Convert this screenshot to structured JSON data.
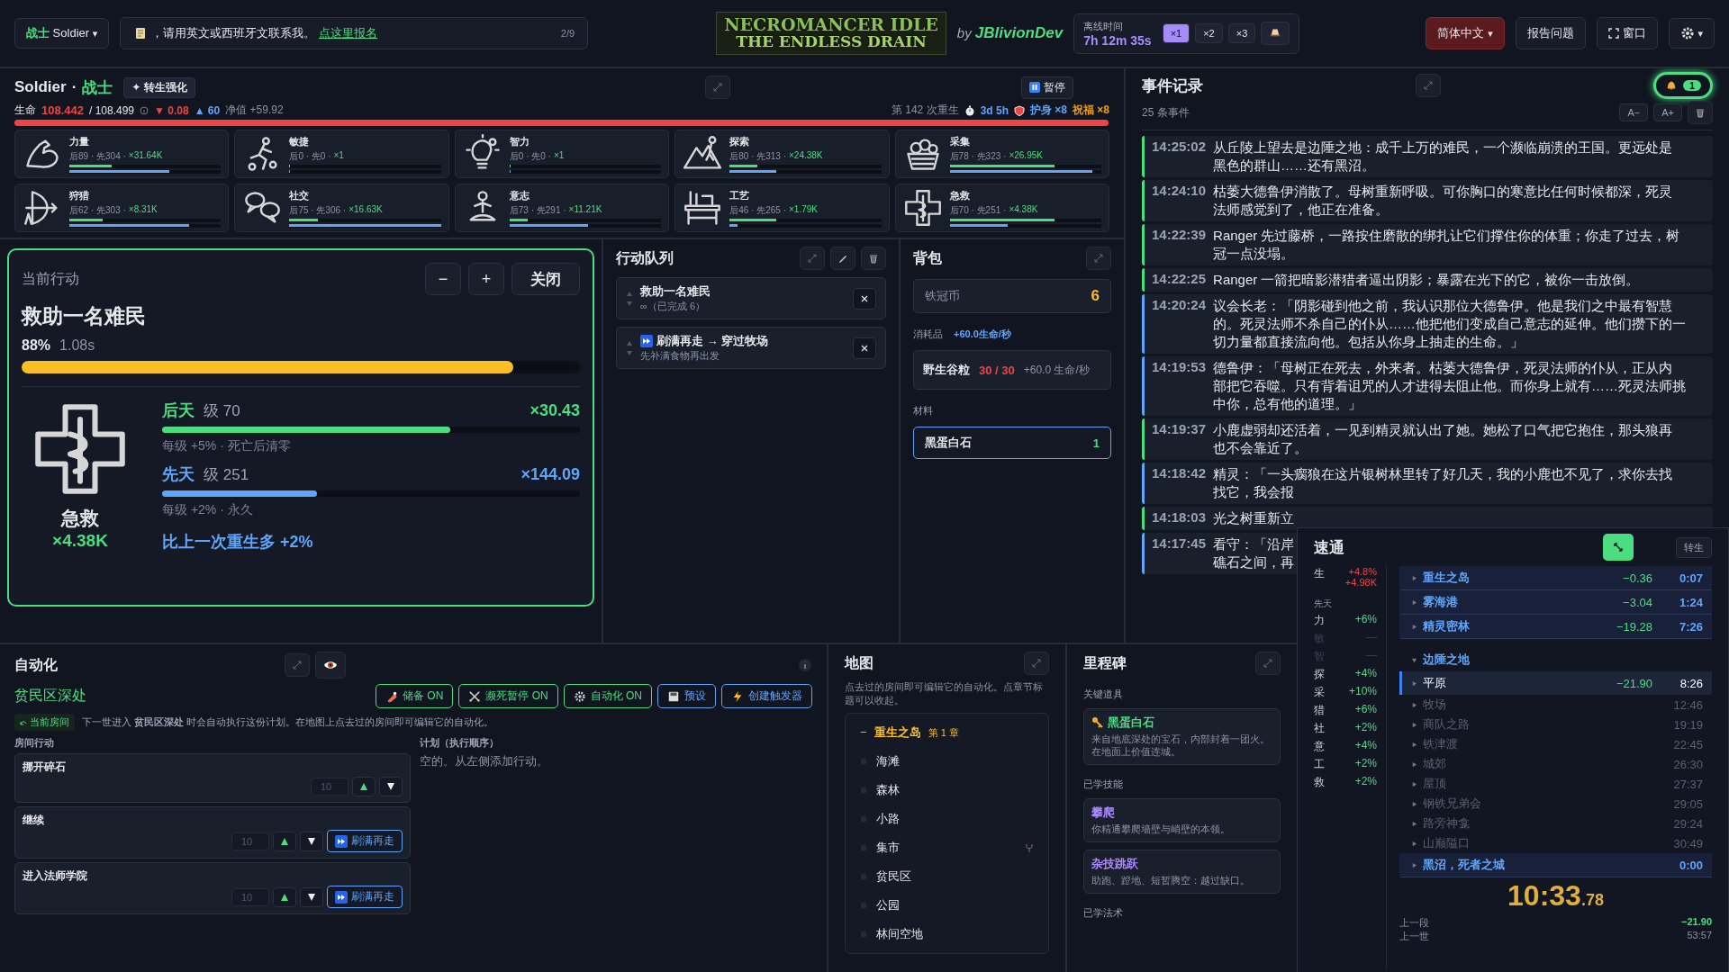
{
  "topbar": {
    "class_select": {
      "label": "战士",
      "value": "Soldier",
      "caret": "▾"
    },
    "notice": {
      "text": "，请用英文或西班牙文联系我。",
      "link": "点这里报名",
      "page": "2/9"
    },
    "logo": {
      "line1": "NECROMANCER IDLE",
      "line2": "THE ENDLESS DRAIN"
    },
    "byline": "by",
    "author": "JBlivionDev",
    "offline": {
      "label": "离线时间",
      "time": "7h 12m 35s"
    },
    "speeds": [
      {
        "label": "×1",
        "selected": true
      },
      {
        "label": "×2",
        "selected": false
      },
      {
        "label": "×3",
        "selected": false
      }
    ],
    "language": "简体中文",
    "language_caret": "▾",
    "report": "报告问题",
    "window_button": "窗口",
    "settings_caret": "▾"
  },
  "character": {
    "name": "Soldier",
    "separator": "·",
    "class": "战士",
    "rebirth_button": "✦ 转生强化",
    "pause_button": "暂停",
    "life_label": "生命",
    "life": "108.442",
    "life_max": "/ 108.499",
    "loss": "▼ 0.08",
    "gain": "▲ 60",
    "net": "净值 +59.92",
    "life_bar": {
      "level": 0.9995
    },
    "rebirths": "第 142 次重生",
    "age": "3d 5h",
    "ward": "护身 ×8",
    "blessing": "祝福 ×8"
  },
  "stats": [
    {
      "name": "力量",
      "detail": "后89 · 先304 ·",
      "mult": "×31.64K",
      "acquired_bar": {
        "level": 0.28
      },
      "innate_bar": {
        "level": 0.66
      }
    },
    {
      "name": "敏捷",
      "detail": "后0 · 先0 ·",
      "mult": "×1",
      "acquired_bar": {
        "level": 0
      },
      "innate_bar": {
        "level": 0
      }
    },
    {
      "name": "智力",
      "detail": "后0 · 先0 ·",
      "mult": "×1",
      "acquired_bar": {
        "level": 0
      },
      "innate_bar": {
        "level": 0
      }
    },
    {
      "name": "探索",
      "detail": "后80 · 先313 ·",
      "mult": "×24.38K",
      "acquired_bar": {
        "level": 0.18
      },
      "innate_bar": {
        "level": 0.31
      }
    },
    {
      "name": "采集",
      "detail": "后78 · 先323 ·",
      "mult": "×26.95K",
      "acquired_bar": {
        "level": 0.69
      },
      "innate_bar": {
        "level": 0.94
      }
    },
    {
      "name": "狩猎",
      "detail": "后62 · 先303 ·",
      "mult": "×8.31K",
      "acquired_bar": {
        "level": 0.22
      },
      "innate_bar": {
        "level": 0.79
      }
    },
    {
      "name": "社交",
      "detail": "后75 · 先306 ·",
      "mult": "×16.63K",
      "acquired_bar": {
        "level": 0.19
      },
      "innate_bar": {
        "level": 1
      }
    },
    {
      "name": "意志",
      "detail": "后73 · 先291 ·",
      "mult": "×11.21K",
      "acquired_bar": {
        "level": 0.12
      },
      "innate_bar": {
        "level": 0.52
      }
    },
    {
      "name": "工艺",
      "detail": "后46 · 先265 ·",
      "mult": "×1.79K",
      "acquired_bar": {
        "level": 0.31
      },
      "innate_bar": {
        "level": 0.05
      }
    },
    {
      "name": "急救",
      "detail": "后70 · 先251 ·",
      "mult": "×4.38K",
      "acquired_bar": {
        "level": 0.69
      },
      "innate_bar": {
        "level": 0.38
      }
    }
  ],
  "current_action": {
    "heading": "当前行动",
    "minus": "−",
    "plus": "+",
    "close": "关闭",
    "title": "救助一名难民",
    "percent": "88%",
    "duration": "1.08s",
    "level": 0.88,
    "skill": "急救",
    "skill_mult": "×4.38K",
    "acquired": {
      "label": "后天",
      "tier": "级 70",
      "mult": "×30.43",
      "level": 0.69,
      "note": "每级 +5% · 死亡后清零"
    },
    "innate": {
      "label": "先天",
      "tier": "级 251",
      "mult": "×144.09",
      "level": 0.37,
      "note": "每级 +2% · 永久"
    },
    "comparison": "比上一次重生多 +2%"
  },
  "queue": {
    "heading": "行动队列",
    "items": [
      {
        "title": "救助一名难民",
        "sub": "∞（已完成 6）",
        "refill": false
      },
      {
        "title": "刷满再走 → 穿过牧场",
        "sub": "先补满食物再出发",
        "refill": true
      }
    ]
  },
  "bag": {
    "heading": "背包",
    "currency": {
      "name": "铁冠币",
      "count": "6"
    },
    "consumables_label": "消耗品",
    "consumables_rate": "+60.0生命/秒",
    "consumables": [
      {
        "name": "野生谷粒",
        "count": "30 / 30",
        "rate": "+60.0 生命/秒"
      }
    ],
    "materials_label": "材料",
    "materials": [
      {
        "name": "黑蛋白石",
        "count": "1"
      }
    ]
  },
  "event_log": {
    "heading": "事件记录",
    "bell_count": "1",
    "count": "25 条事件",
    "smaller": "A−",
    "larger": "A+",
    "entries": [
      {
        "time": "14:25:02",
        "color": "#4ade80",
        "lines": [
          "从丘陵上望去是边陲之地：成千上万的难民，一个濒临崩溃的王国。更远处是",
          "黑色的群山……还有黑沼。"
        ]
      },
      {
        "time": "14:24:10",
        "color": "#4ade80",
        "lines": [
          "枯萎大德鲁伊消散了。母树重新呼吸。可你胸口的寒意比任何时候都深，死灵",
          "法师感觉到了，他正在准备。"
        ]
      },
      {
        "time": "14:22:39",
        "color": "#4ade80",
        "lines": [
          "Ranger 先过藤桥，一路按住磨散的绑扎让它们撑住你的体重；你走了过去，树",
          "冠一点没塌。"
        ]
      },
      {
        "time": "14:22:25",
        "color": "#4ade80",
        "lines": [
          "Ranger 一箭把暗影潜猎者逼出阴影；暴露在光下的它，被你一击放倒。"
        ]
      },
      {
        "time": "14:20:24",
        "color": "#60a5fa",
        "lines": [
          "议会长老：「阴影碰到他之前，我认识那位大德鲁伊。他是我们之中最有智慧",
          "的。死灵法师不杀自己的仆从……他把他们变成自己意志的延伸。他们攒下的一",
          "切力量都直接流向他。包括从你身上抽走的生命。」"
        ]
      },
      {
        "time": "14:19:53",
        "color": "#60a5fa",
        "lines": [
          "德鲁伊：「母树正在死去，外来者。枯萎大德鲁伊，死灵法师的仆从，正从内",
          "部把它吞噬。只有背着诅咒的人才进得去阻止他。而你身上就有……死灵法师挑",
          "中你，总有他的道理。」"
        ]
      },
      {
        "time": "14:19:37",
        "color": "#4ade80",
        "lines": [
          "小鹿虚弱却还活着，一见到精灵就认出了她。她松了口气把它抱住，那头狼再",
          "也不会靠近了。"
        ]
      },
      {
        "time": "14:18:42",
        "color": "#60a5fa",
        "lines": [
          "精灵：「一头瘸狼在这片银树林里转了好几天，我的小鹿也不见了，求你去找",
          "找它，我会报"
        ]
      },
      {
        "time": "14:18:03",
        "color": "#4ade80",
        "lines": [
          "光之树重新立"
        ]
      },
      {
        "time": "14:17:45",
        "color": "#60a5fa",
        "lines": [
          "看守：「沿岸",
          "礁石之间，再"
        ]
      }
    ]
  },
  "speedrun": {
    "heading": "速通",
    "rebirth_button": "转生",
    "life_label": "生",
    "life_pct": "+4.8%",
    "life_abs": "+4.98K",
    "innate_label": "先天",
    "bonuses": [
      {
        "label": "力",
        "value": "+6%",
        "dim": false
      },
      {
        "label": "敏",
        "value": "—",
        "dim": true
      },
      {
        "label": "智",
        "value": "—",
        "dim": true
      },
      {
        "label": "探",
        "value": "+4%",
        "dim": false
      },
      {
        "label": "采",
        "value": "+10%",
        "dim": false
      },
      {
        "label": "猎",
        "value": "+6%",
        "dim": false
      },
      {
        "label": "社",
        "value": "+2%",
        "dim": false
      },
      {
        "label": "意",
        "value": "+4%",
        "dim": false
      },
      {
        "label": "工",
        "value": "+2%",
        "dim": false
      },
      {
        "label": "救",
        "value": "+2%",
        "dim": false
      }
    ],
    "splits": [
      {
        "name": "重生之岛",
        "kind": "done",
        "delta": "−0.36",
        "time": "0:07"
      },
      {
        "name": "雾海港",
        "kind": "done",
        "delta": "−3.04",
        "time": "1:24"
      },
      {
        "name": "精灵密林",
        "kind": "done",
        "delta": "−19.28",
        "time": "7:26"
      },
      {
        "name": "边陲之地",
        "kind": "group",
        "expanded": true,
        "children": [
          {
            "name": "平原",
            "kind": "current",
            "delta": "−21.90",
            "time": "8:26"
          },
          {
            "name": "牧场",
            "kind": "pending",
            "time": "12:46"
          },
          {
            "name": "商队之路",
            "kind": "pending",
            "time": "19:19"
          },
          {
            "name": "铁津渡",
            "kind": "pending",
            "time": "22:45"
          },
          {
            "name": "城郊",
            "kind": "pending",
            "time": "26:30"
          },
          {
            "name": "屋顶",
            "kind": "pending",
            "time": "27:37"
          },
          {
            "name": "钢铁兄弟会",
            "kind": "pending",
            "time": "29:05"
          },
          {
            "name": "路旁神龛",
            "kind": "pending",
            "time": "29:24"
          },
          {
            "name": "山巅隘口",
            "kind": "pending",
            "time": "30:49"
          }
        ]
      },
      {
        "name": "黑沼，死者之城",
        "kind": "done",
        "time": "0:00"
      }
    ],
    "timer": "10:33",
    "timer_fraction": ".78",
    "previous_segment_label": "上一段",
    "previous_segment": "−21.90",
    "previous_life_label": "上一世",
    "previous_life": "53:57"
  },
  "automation": {
    "heading": "自动化",
    "room": "贫民区深处",
    "toggles": [
      {
        "label": "储备 ON",
        "kind": "toggle",
        "on": true
      },
      {
        "label": "濒死暂停 ON",
        "kind": "toggle",
        "on": true
      },
      {
        "label": "自动化 ON",
        "kind": "toggle",
        "on": true
      },
      {
        "label": "预设",
        "kind": "action"
      },
      {
        "label": "创建触发器",
        "kind": "action"
      }
    ],
    "current_room_badge": "当前房间",
    "hint": "下一世进入 **贫民区深处** 时会自动执行这份计划。在地图上点去过的房间即可编辑它的自动化。",
    "actions_label": "房间行动",
    "actions": [
      {
        "name": "挪开碎石",
        "count": "10"
      },
      {
        "name": "继续",
        "count": "10",
        "refill": "刷满再走"
      },
      {
        "name": "进入法师学院",
        "count": "10",
        "refill": "刷满再走"
      }
    ],
    "plan_label": "计划（执行顺序）",
    "plan_empty": "空的。从左侧添加行动。"
  },
  "map": {
    "heading": "地图",
    "hint": "点去过的房间即可编辑它的自动化。点章节标题可以收起。",
    "chapter": {
      "glyph": "−",
      "name": "重生之岛",
      "number": "第 1 章"
    },
    "rooms": [
      {
        "name": "海滩",
        "branch": false
      },
      {
        "name": "森林",
        "branch": false
      },
      {
        "name": "小路",
        "branch": false
      },
      {
        "name": "集市",
        "branch": true
      },
      {
        "name": "贫民区",
        "branch": false
      },
      {
        "name": "公园",
        "branch": false
      },
      {
        "name": "林间空地",
        "branch": false
      }
    ]
  },
  "milestones": {
    "heading": "里程碑",
    "key_items_label": "关键道具",
    "key_items": [
      {
        "name": "黑蛋白石",
        "desc": "来自地底深处的宝石，内部封着一团火。在地面上价值连城。"
      }
    ],
    "skills_label": "已学技能",
    "skills": [
      {
        "name": "攀爬",
        "desc": "你精通攀爬墙壁与峭壁的本领。"
      },
      {
        "name": "杂技跳跃",
        "desc": "助跑、蹬地、短暂腾空：越过缺口。"
      }
    ],
    "spells_label": "已学法术"
  }
}
